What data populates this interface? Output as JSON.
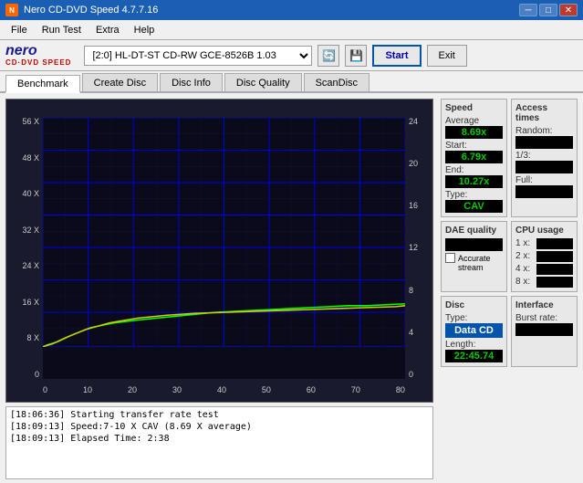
{
  "titlebar": {
    "title": "Nero CD-DVD Speed 4.7.7.16",
    "minimize": "─",
    "maximize": "□",
    "close": "✕"
  },
  "menubar": {
    "items": [
      "File",
      "Run Test",
      "Extra",
      "Help"
    ]
  },
  "toolbar": {
    "logo_nero": "nero",
    "logo_sub": "CD·DVD SPEED",
    "drive_value": "[2:0] HL-DT-ST CD-RW GCE-8526B 1.03",
    "start_label": "Start",
    "exit_label": "Exit"
  },
  "tabs": [
    {
      "label": "Benchmark",
      "active": true
    },
    {
      "label": "Create Disc",
      "active": false
    },
    {
      "label": "Disc Info",
      "active": false
    },
    {
      "label": "Disc Quality",
      "active": false
    },
    {
      "label": "ScanDisc",
      "active": false
    }
  ],
  "chart": {
    "y_labels_left": [
      "56 X",
      "48 X",
      "40 X",
      "32 X",
      "24 X",
      "16 X",
      "8 X",
      "0"
    ],
    "y_labels_right": [
      "24",
      "20",
      "16",
      "12",
      "8",
      "4",
      "0"
    ],
    "x_labels": [
      "0",
      "10",
      "20",
      "30",
      "40",
      "50",
      "60",
      "70",
      "80"
    ]
  },
  "speed_panel": {
    "title": "Speed",
    "average_label": "Average",
    "average_value": "8.69x",
    "start_label": "Start:",
    "start_value": "6.79x",
    "end_label": "End:",
    "end_value": "10.27x",
    "type_label": "Type:",
    "type_value": "CAV"
  },
  "access_panel": {
    "title": "Access times",
    "random_label": "Random:",
    "random_value": "",
    "onethird_label": "1/3:",
    "onethird_value": "",
    "full_label": "Full:",
    "full_value": ""
  },
  "cpu_panel": {
    "title": "CPU usage",
    "one_label": "1 x:",
    "one_value": "",
    "two_label": "2 x:",
    "two_value": "",
    "four_label": "4 x:",
    "four_value": "",
    "eight_label": "8 x:",
    "eight_value": ""
  },
  "dae_panel": {
    "title": "DAE quality",
    "value": "",
    "accurate_label": "Accurate",
    "stream_label": "stream"
  },
  "disc_panel": {
    "title": "Disc",
    "type_label": "Type:",
    "type_value": "Data CD",
    "length_label": "Length:",
    "length_value": "22:45.74"
  },
  "interface_panel": {
    "title": "Interface",
    "burst_label": "Burst rate:",
    "burst_value": ""
  },
  "log": {
    "entries": [
      "[18:06:36]  Starting transfer rate test",
      "[18:09:13]  Speed:7-10 X CAV (8.69 X average)",
      "[18:09:13]  Elapsed Time: 2:38"
    ]
  }
}
